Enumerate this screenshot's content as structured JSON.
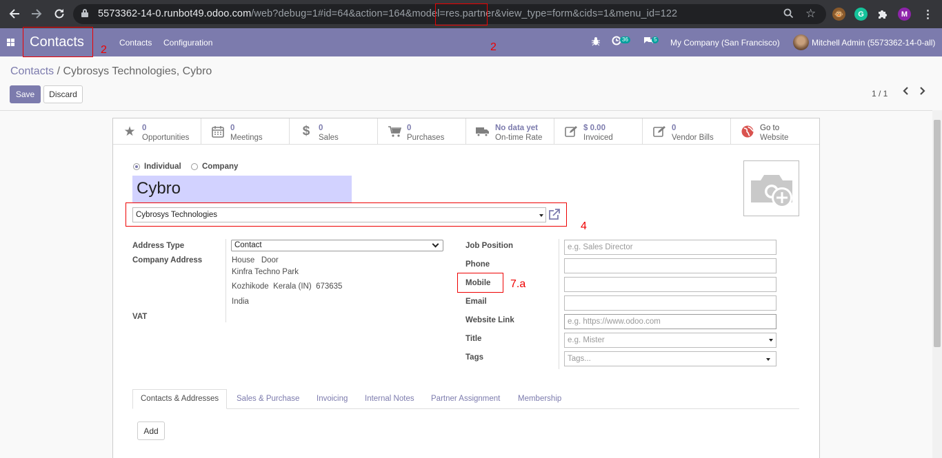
{
  "browser": {
    "url_host": "5573362-14-0.runbot49.odoo.com",
    "url_path": "/web?debug=1#id=64&action=164&model=res.partner&view_type=form&cids=1&menu_id=122",
    "profile_initial": "M"
  },
  "topbar": {
    "brand": "Contacts",
    "menu": [
      "Contacts",
      "Configuration"
    ],
    "activity_count": "36",
    "message_count": "5",
    "company": "My Company (San Francisco)",
    "user": "Mitchell Admin (5573362-14-0-all)"
  },
  "control": {
    "breadcrumb_parent": "Contacts",
    "breadcrumb_sep": "/",
    "breadcrumb_current": "Cybrosys Technologies, Cybro",
    "save": "Save",
    "discard": "Discard",
    "pager": "1 / 1"
  },
  "stats": [
    {
      "value": "0",
      "label": "Opportunities",
      "icon": "star-icon"
    },
    {
      "value": "0",
      "label": "Meetings",
      "icon": "calendar-icon"
    },
    {
      "value": "0",
      "label": "Sales",
      "icon": "dollar-icon"
    },
    {
      "value": "0",
      "label": "Purchases",
      "icon": "cart-icon"
    },
    {
      "value": "No data yet",
      "label": "On-time Rate",
      "icon": "truck-icon"
    },
    {
      "value": "$ 0.00",
      "label": "Invoiced",
      "icon": "edit-icon"
    },
    {
      "value": "0",
      "label": "Vendor Bills",
      "icon": "edit-icon"
    },
    {
      "value": "Go to",
      "label": "Website",
      "icon": "globe-icon"
    }
  ],
  "form": {
    "type_individual": "Individual",
    "type_company": "Company",
    "name": "Cybro",
    "parent_company": "Cybrosys Technologies",
    "address_type_label": "Address Type",
    "address_type_value": "Contact",
    "company_address_label": "Company Address",
    "address_line1": "House   Door",
    "address_line2": "Kinfra Techno Park",
    "address_line3": "Kozhikode  Kerala (IN)  673635",
    "address_line4": "India",
    "vat_label": "VAT",
    "job_position_label": "Job Position",
    "job_position_placeholder": "e.g. Sales Director",
    "phone_label": "Phone",
    "mobile_label": "Mobile",
    "email_label": "Email",
    "website_label": "Website Link",
    "website_placeholder": "e.g. https://www.odoo.com",
    "title_label": "Title",
    "title_placeholder": "e.g. Mister",
    "tags_label": "Tags",
    "tags_placeholder": "Tags..."
  },
  "tabs": [
    "Contacts & Addresses",
    "Sales & Purchase",
    "Invoicing",
    "Internal Notes",
    "Partner Assignment",
    "Membership"
  ],
  "add_button": "Add",
  "annotations": {
    "brand": "2",
    "model": "2",
    "company_field": "4",
    "mobile": "7.a"
  },
  "colors": {
    "primary": "#7c7bad",
    "annotation": "#ee0000",
    "name_bg": "#d2d2ff"
  }
}
